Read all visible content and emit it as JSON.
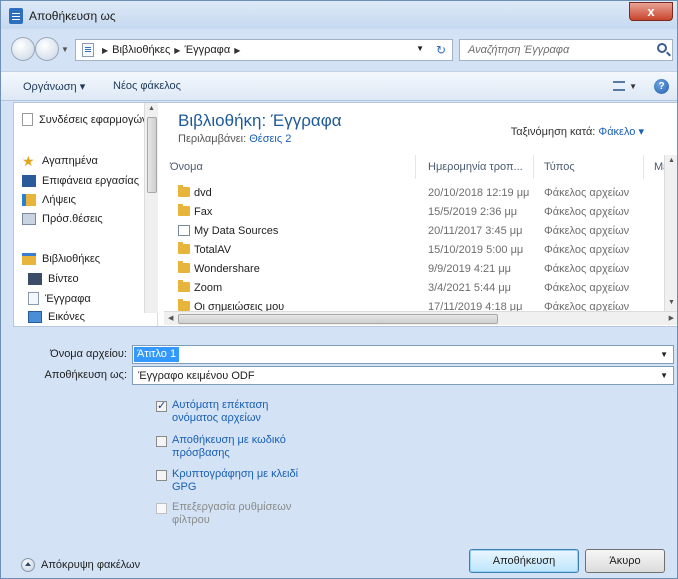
{
  "window": {
    "title": "Αποθήκευση ως",
    "close_glyph": "x"
  },
  "address": {
    "crumbs": [
      "Βιβλιοθήκες",
      "Έγγραφα"
    ],
    "search_placeholder": "Αναζήτηση Έγγραφα"
  },
  "toolbar": {
    "organize_label": "Οργάνωση ▾",
    "new_folder_label": "Νέος φάκελος",
    "help_glyph": "?"
  },
  "nav_pane": {
    "items": [
      {
        "label": "Συνδέσεις εφαρμογών",
        "icon": "page-icon"
      },
      {
        "label": "Αγαπημένα",
        "icon": "star-icon"
      },
      {
        "label": "Επιφάνεια εργασίας",
        "icon": "desktop-icon"
      },
      {
        "label": "Λήψεις",
        "icon": "downloads-icon"
      },
      {
        "label": "Πρόσ.θέσεις",
        "icon": "recent-places-icon"
      },
      {
        "label": "Βιβλιοθήκες",
        "icon": "libraries-icon"
      },
      {
        "label": "Βίντεο",
        "icon": "video-icon"
      },
      {
        "label": "Έγγραφα",
        "icon": "documents-icon"
      },
      {
        "label": "Εικόνες",
        "icon": "pictures-icon"
      }
    ]
  },
  "library": {
    "title": "Βιβλιοθήκη: Έγγραφα",
    "includes_label": "Περιλαμβάνει:",
    "includes_link": "Θέσεις 2",
    "arrange_label": "Ταξινόμηση κατά:",
    "arrange_value": "Φάκελο ▾"
  },
  "columns": [
    "Όνομα",
    "Ημερομηνία τροπ...",
    "Τύπος",
    "Μέ"
  ],
  "files": [
    {
      "name": "dvd",
      "date": "20/10/2018 12:19 μμ",
      "type": "Φάκελος αρχείων",
      "icon": "folder-icon"
    },
    {
      "name": "Fax",
      "date": "15/5/2019 2:36 μμ",
      "type": "Φάκελος αρχείων",
      "icon": "folder-icon"
    },
    {
      "name": "My Data Sources",
      "date": "20/11/2017 3:45 μμ",
      "type": "Φάκελος αρχείων",
      "icon": "database-icon"
    },
    {
      "name": "TotalAV",
      "date": "15/10/2019 5:00 μμ",
      "type": "Φάκελος αρχείων",
      "icon": "folder-icon"
    },
    {
      "name": "Wondershare",
      "date": "9/9/2019 4:21 μμ",
      "type": "Φάκελος αρχείων",
      "icon": "folder-icon"
    },
    {
      "name": "Zoom",
      "date": "3/4/2021 5:44 μμ",
      "type": "Φάκελος αρχείων",
      "icon": "folder-icon"
    },
    {
      "name": "Οι σημειώσεις μου",
      "date": "17/11/2019 4:18 μμ",
      "type": "Φάκελος αρχείων",
      "icon": "folder-icon"
    }
  ],
  "form": {
    "filename_label": "Όνομα αρχείου:",
    "filename_value": "Άτιτλο 1",
    "savetype_label": "Αποθήκευση ως:",
    "savetype_value": "Έγγραφο κειμένου ODF"
  },
  "options": [
    {
      "label": "Αυτόματη επέκταση ονόματος αρχείων",
      "checked": true,
      "enabled": true
    },
    {
      "label": "Αποθήκευση με κωδικό πρόσβασης",
      "checked": false,
      "enabled": true
    },
    {
      "label": "Κρυπτογράφηση με κλειδί GPG",
      "checked": false,
      "enabled": true
    },
    {
      "label": "Επεξεργασία ρυθμίσεων φίλτρου",
      "checked": false,
      "enabled": false
    }
  ],
  "footer": {
    "hide_folders_label": "Απόκρυψη φακέλων",
    "save_label": "Αποθήκευση",
    "cancel_label": "Άκυρο"
  },
  "colors": {
    "accent": "#1e5a9a",
    "selection": "#3399ff",
    "folder": "#e8b53c"
  }
}
